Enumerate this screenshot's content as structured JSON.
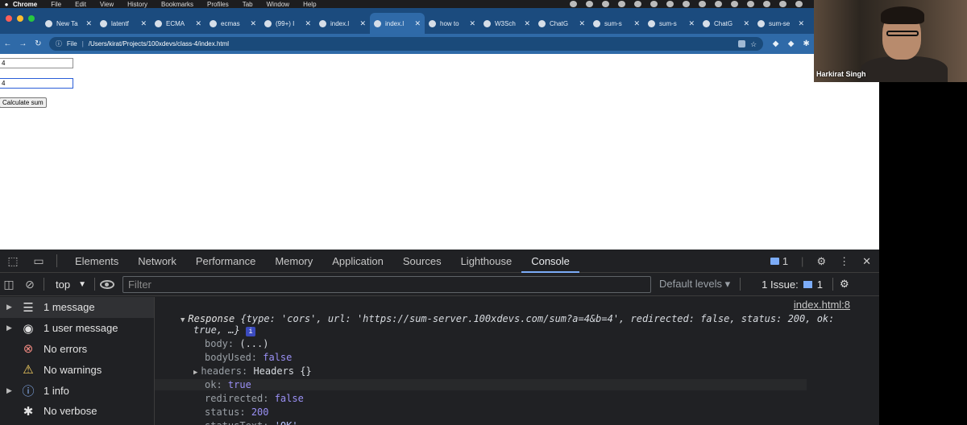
{
  "menubar": {
    "app": "Chrome",
    "items": [
      "File",
      "Edit",
      "View",
      "History",
      "Bookmarks",
      "Profiles",
      "Tab",
      "Window",
      "Help"
    ]
  },
  "tabs": [
    {
      "label": "New Ta",
      "active": false
    },
    {
      "label": "latentf",
      "active": false
    },
    {
      "label": "ECMA",
      "active": false
    },
    {
      "label": "ecmas",
      "active": false
    },
    {
      "label": "(99+) I",
      "active": false
    },
    {
      "label": "index.l",
      "active": false
    },
    {
      "label": "index.l",
      "active": true
    },
    {
      "label": "how to",
      "active": false
    },
    {
      "label": "W3Sch",
      "active": false
    },
    {
      "label": "ChatG",
      "active": false
    },
    {
      "label": "sum-s",
      "active": false
    },
    {
      "label": "sum-s",
      "active": false
    },
    {
      "label": "ChatG",
      "active": false
    },
    {
      "label": "sum-se",
      "active": false
    }
  ],
  "addressbar": {
    "scheme_label": "File",
    "url": "/Users/kirat/Projects/100xdevs/class-4/index.html"
  },
  "page": {
    "input_a_value": "4",
    "input_b_value": "4",
    "calc_button": "Calculate sum"
  },
  "video": {
    "name": "Harkirat Singh"
  },
  "devtools": {
    "tabs": [
      "Elements",
      "Network",
      "Performance",
      "Memory",
      "Application",
      "Sources",
      "Lighthouse",
      "Console"
    ],
    "active_tab": "Console",
    "issue_badge_count": "1",
    "context": "top",
    "filter_placeholder": "Filter",
    "levels": "Default levels",
    "issues_label": "1 Issue:",
    "issues_count": "1",
    "sidebar": [
      {
        "label": "1 message",
        "icon": "list-icon",
        "has_arrow": true
      },
      {
        "label": "1 user message",
        "icon": "user-icon",
        "has_arrow": true
      },
      {
        "label": "No errors",
        "icon": "error-icon",
        "has_arrow": false
      },
      {
        "label": "No warnings",
        "icon": "warning-icon",
        "has_arrow": false
      },
      {
        "label": "1 info",
        "icon": "info-icon",
        "has_arrow": true
      },
      {
        "label": "No verbose",
        "icon": "bug-icon",
        "has_arrow": false
      }
    ],
    "console": {
      "source_link": "index.html:8",
      "response_prefix": "Response",
      "response_line1": "{type: 'cors', url: 'https://sum-server.100xdevs.com/sum?a=4&b=4', redirected: false, status: 200, ok:",
      "response_line2": "true, …}",
      "props": [
        {
          "key": "body",
          "value": "(...)",
          "kind": "plain",
          "expandable": false
        },
        {
          "key": "bodyUsed",
          "value": "false",
          "kind": "bool",
          "expandable": false
        },
        {
          "key": "headers",
          "value": "Headers {}",
          "kind": "plain",
          "expandable": true
        },
        {
          "key": "ok",
          "value": "true",
          "kind": "bool",
          "expandable": false
        },
        {
          "key": "redirected",
          "value": "false",
          "kind": "bool",
          "expandable": false
        },
        {
          "key": "status",
          "value": "200",
          "kind": "num",
          "expandable": false
        },
        {
          "key": "statusText",
          "value": "'OK'",
          "kind": "str",
          "expandable": false
        }
      ]
    }
  },
  "colors": {
    "tab_strip": "#1b4b7e",
    "toolbar": "#2f6aa8",
    "devtools_bg": "#202124",
    "accent": "#7cacf8"
  }
}
